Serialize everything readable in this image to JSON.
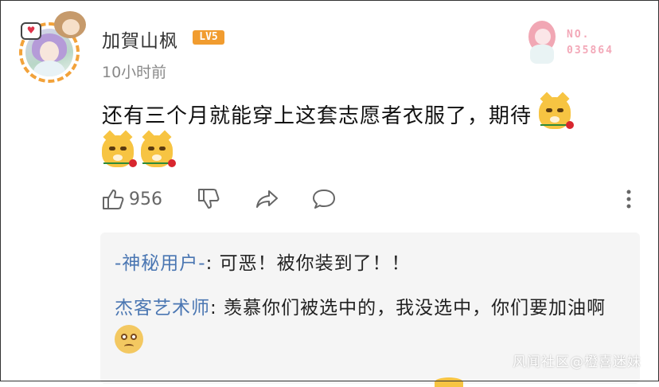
{
  "header": {
    "username": "加賀山枫",
    "level_badge": "LV5",
    "timestamp": "10小时前",
    "card": {
      "label": "NO.",
      "number": "035864"
    }
  },
  "comment": {
    "text": "还有三个月就能穿上这套志愿者衣服了，期待",
    "emojis": [
      "dog-rose-emoji",
      "dog-rose-emoji",
      "dog-rose-emoji"
    ]
  },
  "actions": {
    "like_count": "956",
    "icons": [
      "thumbs-up-icon",
      "thumbs-down-icon",
      "share-icon",
      "comment-icon",
      "more-icon"
    ]
  },
  "replies": [
    {
      "user": "-神秘用户-",
      "separator": ": ",
      "text": "可恶！被你装到了！！"
    },
    {
      "user": "杰客艺术师",
      "separator": ": ",
      "text": "羡慕你们被选中的，我没选中，你们要加油啊",
      "emoji": "worried-face-emoji"
    }
  ],
  "watermark": "风闻社区@橙喜迷妹",
  "colors": {
    "accent_orange": "#f19c2f",
    "reply_user_blue": "#4a76b2",
    "reply_bg": "#f5f5f5"
  }
}
